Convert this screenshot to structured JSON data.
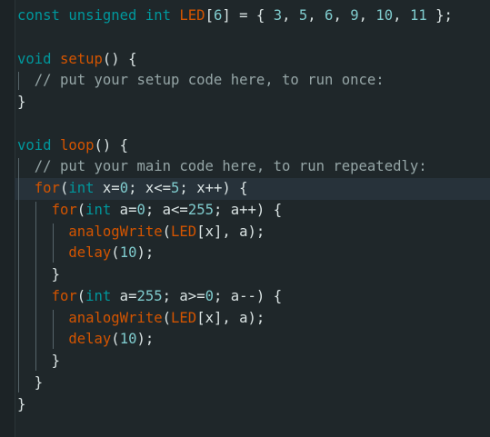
{
  "editor": {
    "lines": [
      {
        "indent": "",
        "tokens": [
          {
            "t": "const",
            "c": "kw"
          },
          {
            "t": " ",
            "c": "txt"
          },
          {
            "t": "unsigned",
            "c": "kw"
          },
          {
            "t": " ",
            "c": "txt"
          },
          {
            "t": "int",
            "c": "kw"
          },
          {
            "t": " ",
            "c": "txt"
          },
          {
            "t": "LED",
            "c": "fn"
          },
          {
            "t": "[",
            "c": "txt"
          },
          {
            "t": "6",
            "c": "lit"
          },
          {
            "t": "] = { ",
            "c": "txt"
          },
          {
            "t": "3",
            "c": "lit"
          },
          {
            "t": ", ",
            "c": "txt"
          },
          {
            "t": "5",
            "c": "lit"
          },
          {
            "t": ", ",
            "c": "txt"
          },
          {
            "t": "6",
            "c": "lit"
          },
          {
            "t": ", ",
            "c": "txt"
          },
          {
            "t": "9",
            "c": "lit"
          },
          {
            "t": ", ",
            "c": "txt"
          },
          {
            "t": "10",
            "c": "lit"
          },
          {
            "t": ", ",
            "c": "txt"
          },
          {
            "t": "11",
            "c": "lit"
          },
          {
            "t": " };",
            "c": "txt"
          }
        ]
      },
      {
        "indent": "",
        "tokens": []
      },
      {
        "indent": "",
        "tokens": [
          {
            "t": "void",
            "c": "kw"
          },
          {
            "t": " ",
            "c": "txt"
          },
          {
            "t": "setup",
            "c": "fn"
          },
          {
            "t": "() {",
            "c": "txt"
          }
        ]
      },
      {
        "indent": "  ",
        "tokens": [
          {
            "t": "// put your setup code here, to run once:",
            "c": "cmt"
          }
        ]
      },
      {
        "indent": "",
        "tokens": [
          {
            "t": "}",
            "c": "txt"
          }
        ]
      },
      {
        "indent": "",
        "tokens": []
      },
      {
        "indent": "",
        "tokens": [
          {
            "t": "void",
            "c": "kw"
          },
          {
            "t": " ",
            "c": "txt"
          },
          {
            "t": "loop",
            "c": "fn"
          },
          {
            "t": "() {",
            "c": "txt"
          }
        ]
      },
      {
        "indent": "  ",
        "tokens": [
          {
            "t": "// put your main code here, to run repeatedly:",
            "c": "cmt"
          }
        ]
      },
      {
        "indent": "  ",
        "current": true,
        "tokens": [
          {
            "t": "for",
            "c": "fn"
          },
          {
            "t": "(",
            "c": "txt"
          },
          {
            "t": "int",
            "c": "kw"
          },
          {
            "t": " x=",
            "c": "txt"
          },
          {
            "t": "0",
            "c": "lit"
          },
          {
            "t": "; x<=",
            "c": "txt"
          },
          {
            "t": "5",
            "c": "lit"
          },
          {
            "t": "; x++) {",
            "c": "txt"
          }
        ]
      },
      {
        "indent": "    ",
        "tokens": [
          {
            "t": "for",
            "c": "fn"
          },
          {
            "t": "(",
            "c": "txt"
          },
          {
            "t": "int",
            "c": "kw"
          },
          {
            "t": " a=",
            "c": "txt"
          },
          {
            "t": "0",
            "c": "lit"
          },
          {
            "t": "; a<=",
            "c": "txt"
          },
          {
            "t": "255",
            "c": "lit"
          },
          {
            "t": "; a++) {",
            "c": "txt"
          }
        ]
      },
      {
        "indent": "      ",
        "tokens": [
          {
            "t": "analogWrite",
            "c": "fn"
          },
          {
            "t": "(",
            "c": "txt"
          },
          {
            "t": "LED",
            "c": "fn"
          },
          {
            "t": "[x], a);",
            "c": "txt"
          }
        ]
      },
      {
        "indent": "      ",
        "tokens": [
          {
            "t": "delay",
            "c": "fn"
          },
          {
            "t": "(",
            "c": "txt"
          },
          {
            "t": "10",
            "c": "lit"
          },
          {
            "t": ");",
            "c": "txt"
          }
        ]
      },
      {
        "indent": "    ",
        "tokens": [
          {
            "t": "}",
            "c": "txt"
          }
        ]
      },
      {
        "indent": "    ",
        "tokens": [
          {
            "t": "for",
            "c": "fn"
          },
          {
            "t": "(",
            "c": "txt"
          },
          {
            "t": "int",
            "c": "kw"
          },
          {
            "t": " a=",
            "c": "txt"
          },
          {
            "t": "255",
            "c": "lit"
          },
          {
            "t": "; a>=",
            "c": "txt"
          },
          {
            "t": "0",
            "c": "lit"
          },
          {
            "t": "; a--) {",
            "c": "txt"
          }
        ]
      },
      {
        "indent": "      ",
        "tokens": [
          {
            "t": "analogWrite",
            "c": "fn"
          },
          {
            "t": "(",
            "c": "txt"
          },
          {
            "t": "LED",
            "c": "fn"
          },
          {
            "t": "[x], a);",
            "c": "txt"
          }
        ]
      },
      {
        "indent": "      ",
        "tokens": [
          {
            "t": "delay",
            "c": "fn"
          },
          {
            "t": "(",
            "c": "txt"
          },
          {
            "t": "10",
            "c": "lit"
          },
          {
            "t": ");",
            "c": "txt"
          }
        ]
      },
      {
        "indent": "    ",
        "tokens": [
          {
            "t": "}",
            "c": "txt"
          }
        ]
      },
      {
        "indent": "  ",
        "tokens": [
          {
            "t": "}",
            "c": "txt"
          }
        ]
      },
      {
        "indent": "",
        "tokens": [
          {
            "t": "}",
            "c": "txt"
          }
        ]
      }
    ]
  },
  "colors": {
    "background": "#1f272a",
    "keyword": "#00979c",
    "function": "#d35400",
    "literal": "#7fcbcd",
    "comment": "#95a5a6",
    "text": "#dae3e3"
  }
}
